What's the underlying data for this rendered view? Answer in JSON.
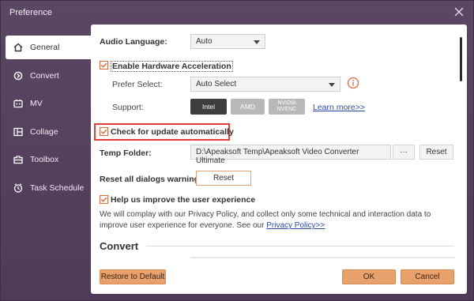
{
  "window": {
    "title": "Preference"
  },
  "sidebar": {
    "items": [
      {
        "label": "General",
        "icon": "home-icon",
        "active": true
      },
      {
        "label": "Convert",
        "icon": "convert-icon",
        "active": false
      },
      {
        "label": "MV",
        "icon": "mv-icon",
        "active": false
      },
      {
        "label": "Collage",
        "icon": "collage-icon",
        "active": false
      },
      {
        "label": "Toolbox",
        "icon": "toolbox-icon",
        "active": false
      },
      {
        "label": "Task Schedule",
        "icon": "clock-icon",
        "active": false
      }
    ]
  },
  "general": {
    "audio_language_label": "Audio Language:",
    "audio_language_value": "Auto",
    "hw_accel_label": "Enable Hardware Acceleration",
    "hw_accel_checked": true,
    "prefer_select_label": "Prefer Select:",
    "prefer_select_value": "Auto Select",
    "support_label": "Support:",
    "support_chips": [
      {
        "label": "Intel",
        "enabled": true
      },
      {
        "label": "AMD",
        "enabled": false
      },
      {
        "label": "NVIDIA NVENC",
        "enabled": false
      }
    ],
    "learn_more": "Learn more>>",
    "check_update_label": "Check for update automatically",
    "check_update_checked": true,
    "temp_folder_label": "Temp Folder:",
    "temp_folder_value": "D:\\Apeaksoft Temp\\Apeaksoft Video Converter Ultimate",
    "browse_label": "···",
    "temp_reset_label": "Reset",
    "reset_dialogs_label": "Reset all dialogs warnings:",
    "reset_dialogs_button": "Reset",
    "improve_label": "Help us improve the user experience",
    "improve_checked": true,
    "privacy_text": "We will complay with our Privacy Policy, and collect only some technical and interaction data to improve user experience for everyone. See our",
    "privacy_link": "Privacy Policy>>",
    "convert_section_title": "Convert"
  },
  "footer": {
    "restore_label": "Restore to Default",
    "ok_label": "OK",
    "cancel_label": "Cancel"
  },
  "colors": {
    "accent": "#e8a06c",
    "checkbox": "#e2673b",
    "highlight": "#e53b3b",
    "window_bg": "#5b4763"
  }
}
